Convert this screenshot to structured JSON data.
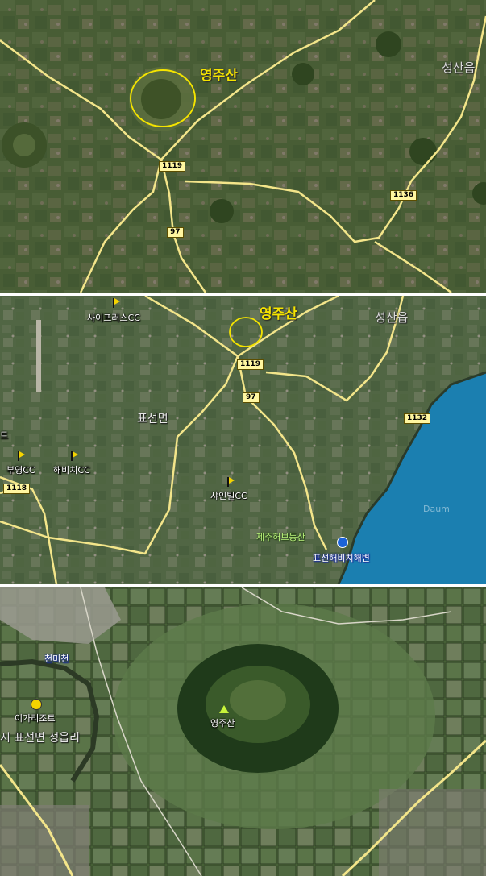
{
  "panel1": {
    "labels": {
      "yeongjusan": "영주산",
      "seongsaneup": "성산읍"
    },
    "shields": {
      "r1119": "1119",
      "r97": "97",
      "r1136": "1136"
    }
  },
  "panel2": {
    "labels": {
      "yeongjusan": "영주산",
      "seongsaneup": "성산읍",
      "pyoseonmyeon": "표선면",
      "cypress_cc": "사이프러스CC",
      "buyoung_cc": "부영CC",
      "haebichi_cc": "해비치CC",
      "shinebill_cc": "샤인빌CC",
      "herb": "제주허브동산",
      "beach": "표선해비치해변",
      "edge_char": "트",
      "watermark": "Daum"
    },
    "shields": {
      "r1119": "1119",
      "r97": "97",
      "r1132": "1132",
      "r1118": "1118"
    }
  },
  "panel3": {
    "labels": {
      "cheonmicheon": "천미천",
      "igari_resort": "이가리조트",
      "address": "시 표선면 성읍리",
      "peak": "영주산"
    }
  },
  "colors": {
    "road": "#f3e58a",
    "highlight_circle": "#f5e400",
    "sea": "#1b7fb0"
  },
  "icons": {
    "golf": "golf-flag-icon",
    "resort": "resort-icon",
    "mountain": "mountain-peak-icon",
    "beach": "beach-icon"
  }
}
